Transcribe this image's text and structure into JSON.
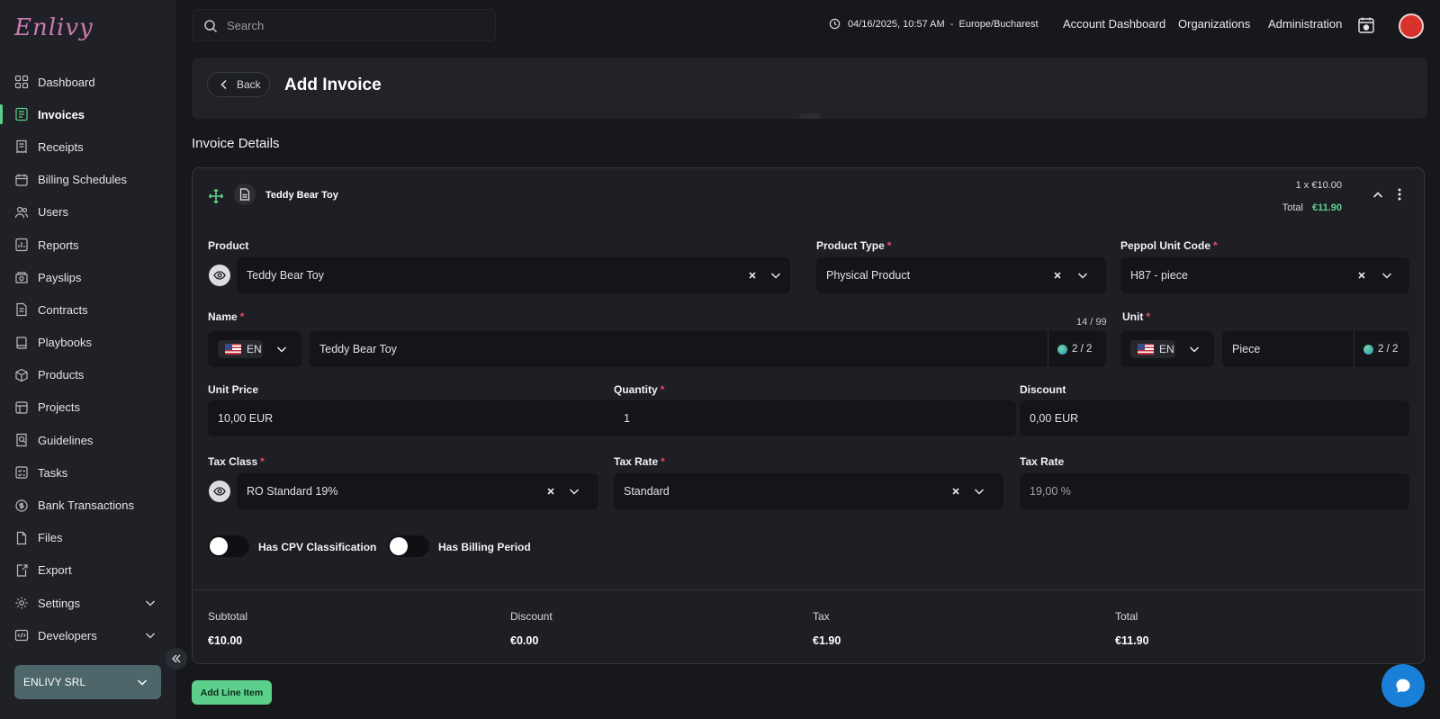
{
  "app": {
    "logo": "Enlivy"
  },
  "sidebar": {
    "items": [
      {
        "label": "Dashboard",
        "icon": "dashboard-icon"
      },
      {
        "label": "Invoices",
        "icon": "invoice-icon"
      },
      {
        "label": "Receipts",
        "icon": "receipt-icon"
      },
      {
        "label": "Billing Schedules",
        "icon": "calendar-icon"
      },
      {
        "label": "Users",
        "icon": "users-icon"
      },
      {
        "label": "Reports",
        "icon": "report-icon"
      },
      {
        "label": "Payslips",
        "icon": "payslip-icon"
      },
      {
        "label": "Contracts",
        "icon": "contract-icon"
      },
      {
        "label": "Playbooks",
        "icon": "book-icon"
      },
      {
        "label": "Products",
        "icon": "box-icon"
      },
      {
        "label": "Projects",
        "icon": "project-icon"
      },
      {
        "label": "Guidelines",
        "icon": "guideline-icon"
      },
      {
        "label": "Tasks",
        "icon": "tasks-icon"
      },
      {
        "label": "Bank Transactions",
        "icon": "bank-icon"
      },
      {
        "label": "Files",
        "icon": "file-icon"
      },
      {
        "label": "Export",
        "icon": "export-icon"
      },
      {
        "label": "Settings",
        "icon": "gear-icon"
      },
      {
        "label": "Developers",
        "icon": "code-icon"
      }
    ],
    "active": "Invoices",
    "organization": "ENLIVY SRL"
  },
  "topbar": {
    "search_placeholder": "Search",
    "datetime": "04/16/2025, 10:57 AM",
    "timezone": "Europe/Bucharest",
    "nav": [
      "Account Dashboard",
      "Organizations",
      "Administration"
    ]
  },
  "header": {
    "back_label": "Back",
    "title": "Add Invoice"
  },
  "section_title": "Invoice Details",
  "line_item": {
    "name": "Teddy Bear Toy",
    "qty_price": "1 x €10.00",
    "total_label": "Total",
    "total_value": "€11.90",
    "product": {
      "label": "Product",
      "value": "Teddy Bear Toy"
    },
    "product_type": {
      "label": "Product Type",
      "value": "Physical Product"
    },
    "peppol_unit_code": {
      "label": "Peppol Unit Code",
      "value": "H87 - piece"
    },
    "name_field": {
      "label": "Name",
      "lang": "EN",
      "value": "Teddy Bear Toy",
      "counter": "14 / 99",
      "translations": "2 / 2"
    },
    "unit": {
      "label": "Unit",
      "lang": "EN",
      "value": "Piece",
      "translations": "2 / 2"
    },
    "unit_price": {
      "label": "Unit Price",
      "value": "10,00 EUR"
    },
    "quantity": {
      "label": "Quantity",
      "value": "1"
    },
    "discount": {
      "label": "Discount",
      "value": "0,00 EUR"
    },
    "tax_class": {
      "label": "Tax Class",
      "value": "RO Standard 19%"
    },
    "tax_rate_select": {
      "label": "Tax Rate",
      "value": "Standard"
    },
    "tax_rate_value": {
      "label": "Tax Rate",
      "value": "19,00 %"
    },
    "toggles": [
      {
        "label": "Has CPV Classification",
        "on": false
      },
      {
        "label": "Has Billing Period",
        "on": false
      }
    ],
    "summary": {
      "subtotal": {
        "label": "Subtotal",
        "value": "€10.00"
      },
      "discount": {
        "label": "Discount",
        "value": "€0.00"
      },
      "tax": {
        "label": "Tax",
        "value": "€1.90"
      },
      "total": {
        "label": "Total",
        "value": "€11.90"
      }
    }
  },
  "actions": {
    "add_line_item": "Add Line Item"
  },
  "colors": {
    "accent": "#5cd08a",
    "required": "#e34b5a",
    "chat": "#1a7fd6",
    "org": "#4c6669"
  }
}
